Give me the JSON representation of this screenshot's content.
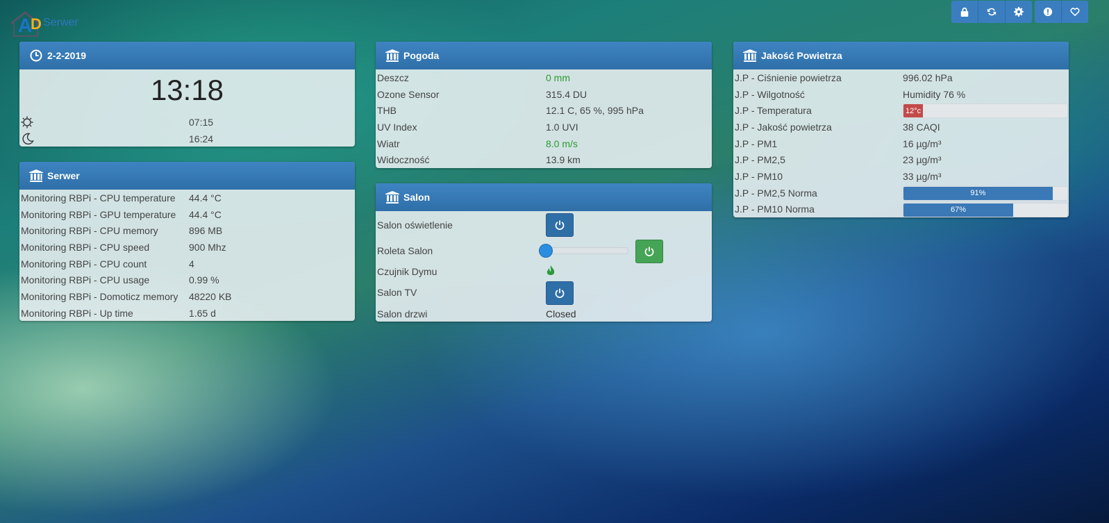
{
  "logo": {
    "letters": "AD",
    "name": "Serwer"
  },
  "toolbar": {
    "group1": [
      "lock-icon",
      "refresh-icon",
      "gear-icon"
    ],
    "group2": [
      "info-icon",
      "heart-icon"
    ]
  },
  "clock_panel": {
    "date": "2-2-2019",
    "time": "13:18",
    "sunrise": "07:15",
    "sunset": "16:24"
  },
  "server_panel": {
    "title": "Serwer",
    "rows": [
      {
        "label": "Monitoring RBPi - CPU temperature",
        "value": "44.4 °C"
      },
      {
        "label": "Monitoring RBPi - GPU temperature",
        "value": "44.4 °C"
      },
      {
        "label": "Monitoring RBPi - CPU memory",
        "value": "896 MB"
      },
      {
        "label": "Monitoring RBPi - CPU speed",
        "value": "900 Mhz"
      },
      {
        "label": "Monitoring RBPi - CPU count",
        "value": "4"
      },
      {
        "label": "Monitoring RBPi - CPU usage",
        "value": "0.99 %"
      },
      {
        "label": "Monitoring RBPi - Domoticz memory",
        "value": "48220 KB"
      },
      {
        "label": "Monitoring RBPi - Up time",
        "value": "1.65 d"
      }
    ]
  },
  "weather_panel": {
    "title": "Pogoda",
    "rows": [
      {
        "label": "Deszcz",
        "value": "0 mm",
        "color": "#2c9a30"
      },
      {
        "label": "Ozone Sensor",
        "value": "315.4 DU"
      },
      {
        "label": "THB",
        "value": "12.1 C, 65 %, 995 hPa"
      },
      {
        "label": "UV Index",
        "value": "1.0 UVI"
      },
      {
        "label": "Wiatr",
        "value": "8.0 m/s",
        "color": "#2c9a30"
      },
      {
        "label": "Widoczność",
        "value": "13.9 km"
      }
    ]
  },
  "salon_panel": {
    "title": "Salon",
    "rows": {
      "light": "Salon oświetlenie",
      "blind": "Roleta Salon",
      "smoke": "Czujnik Dymu",
      "tv": "Salon TV",
      "door": "Salon drzwi",
      "door_value": "Closed"
    },
    "blind_level": 0
  },
  "air_panel": {
    "title": "Jakość Powietrza",
    "rows": [
      {
        "label": "J.P - Ciśnienie powietrza",
        "value": "996.02 hPa"
      },
      {
        "label": "J.P - Wilgotność",
        "value": "Humidity 76 %"
      },
      {
        "label": "J.P - Temperatura",
        "value": "12°c"
      },
      {
        "label": "J.P - Jakość powietrza",
        "value": "38 CAQI"
      },
      {
        "label": "J.P - PM1",
        "value": "16 µg/m³"
      },
      {
        "label": "J.P - PM2,5",
        "value": "23 µg/m³"
      },
      {
        "label": "J.P - PM10",
        "value": "33 µg/m³"
      },
      {
        "label": "J.P - PM2,5 Norma",
        "value": "91%"
      },
      {
        "label": "J.P - PM10 Norma",
        "value": "67%"
      }
    ],
    "temperature_fill": 0.12,
    "pm25_norma_fill": 0.91,
    "pm10_norma_fill": 0.67
  },
  "colors": {
    "accent": "#3b7ec0",
    "good": "#2c9a30",
    "alert": "#c24a4a"
  }
}
